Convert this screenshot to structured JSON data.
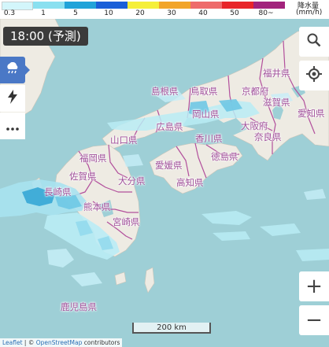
{
  "legend": {
    "swatches": [
      {
        "color": "#d3f6fb"
      },
      {
        "color": "#8ae0f0"
      },
      {
        "color": "#21a3d9"
      },
      {
        "color": "#1a5fd8"
      },
      {
        "color": "#f5ef3a"
      },
      {
        "color": "#f2a52a"
      },
      {
        "color": "#ee6b6b"
      },
      {
        "color": "#e8262a"
      },
      {
        "color": "#a2237c"
      }
    ],
    "levels": [
      "0.3",
      "1",
      "5",
      "10",
      "20",
      "30",
      "40",
      "50",
      "80~"
    ],
    "unit_title": "降水量",
    "unit": "(mm/h)"
  },
  "time": {
    "label": "18:00 (予測)"
  },
  "tools": {
    "rain": "rain-icon",
    "thunder": "lightning-icon",
    "more": "more-icon"
  },
  "controls": {
    "search": "search-icon",
    "locate": "locate-icon",
    "zoom_in": "+",
    "zoom_out": "−"
  },
  "prefectures": [
    {
      "name": "福井県"
    },
    {
      "name": "島根県"
    },
    {
      "name": "鳥取県"
    },
    {
      "name": "京都府"
    },
    {
      "name": "滋賀県"
    },
    {
      "name": "愛知県"
    },
    {
      "name": "岡山県"
    },
    {
      "name": "広島県"
    },
    {
      "name": "大阪府"
    },
    {
      "name": "奈良県"
    },
    {
      "name": "山口県"
    },
    {
      "name": "香川県"
    },
    {
      "name": "福岡県"
    },
    {
      "name": "徳島県"
    },
    {
      "name": "愛媛県"
    },
    {
      "name": "佐賀県"
    },
    {
      "name": "大分県"
    },
    {
      "name": "高知県"
    },
    {
      "name": "長崎県"
    },
    {
      "name": "熊本県"
    },
    {
      "name": "宮崎県"
    },
    {
      "name": "鹿児島県"
    }
  ],
  "scale": {
    "label": "200 km"
  },
  "attribution": {
    "leaflet": "Leaflet",
    "sep": " | © ",
    "osm": "OpenStreetMap",
    "rest": " contributors"
  },
  "colors": {
    "sea": "#9ecfd6",
    "land": "#f0ece4",
    "border": "#b24f9c",
    "accent": "#4a78c6"
  }
}
